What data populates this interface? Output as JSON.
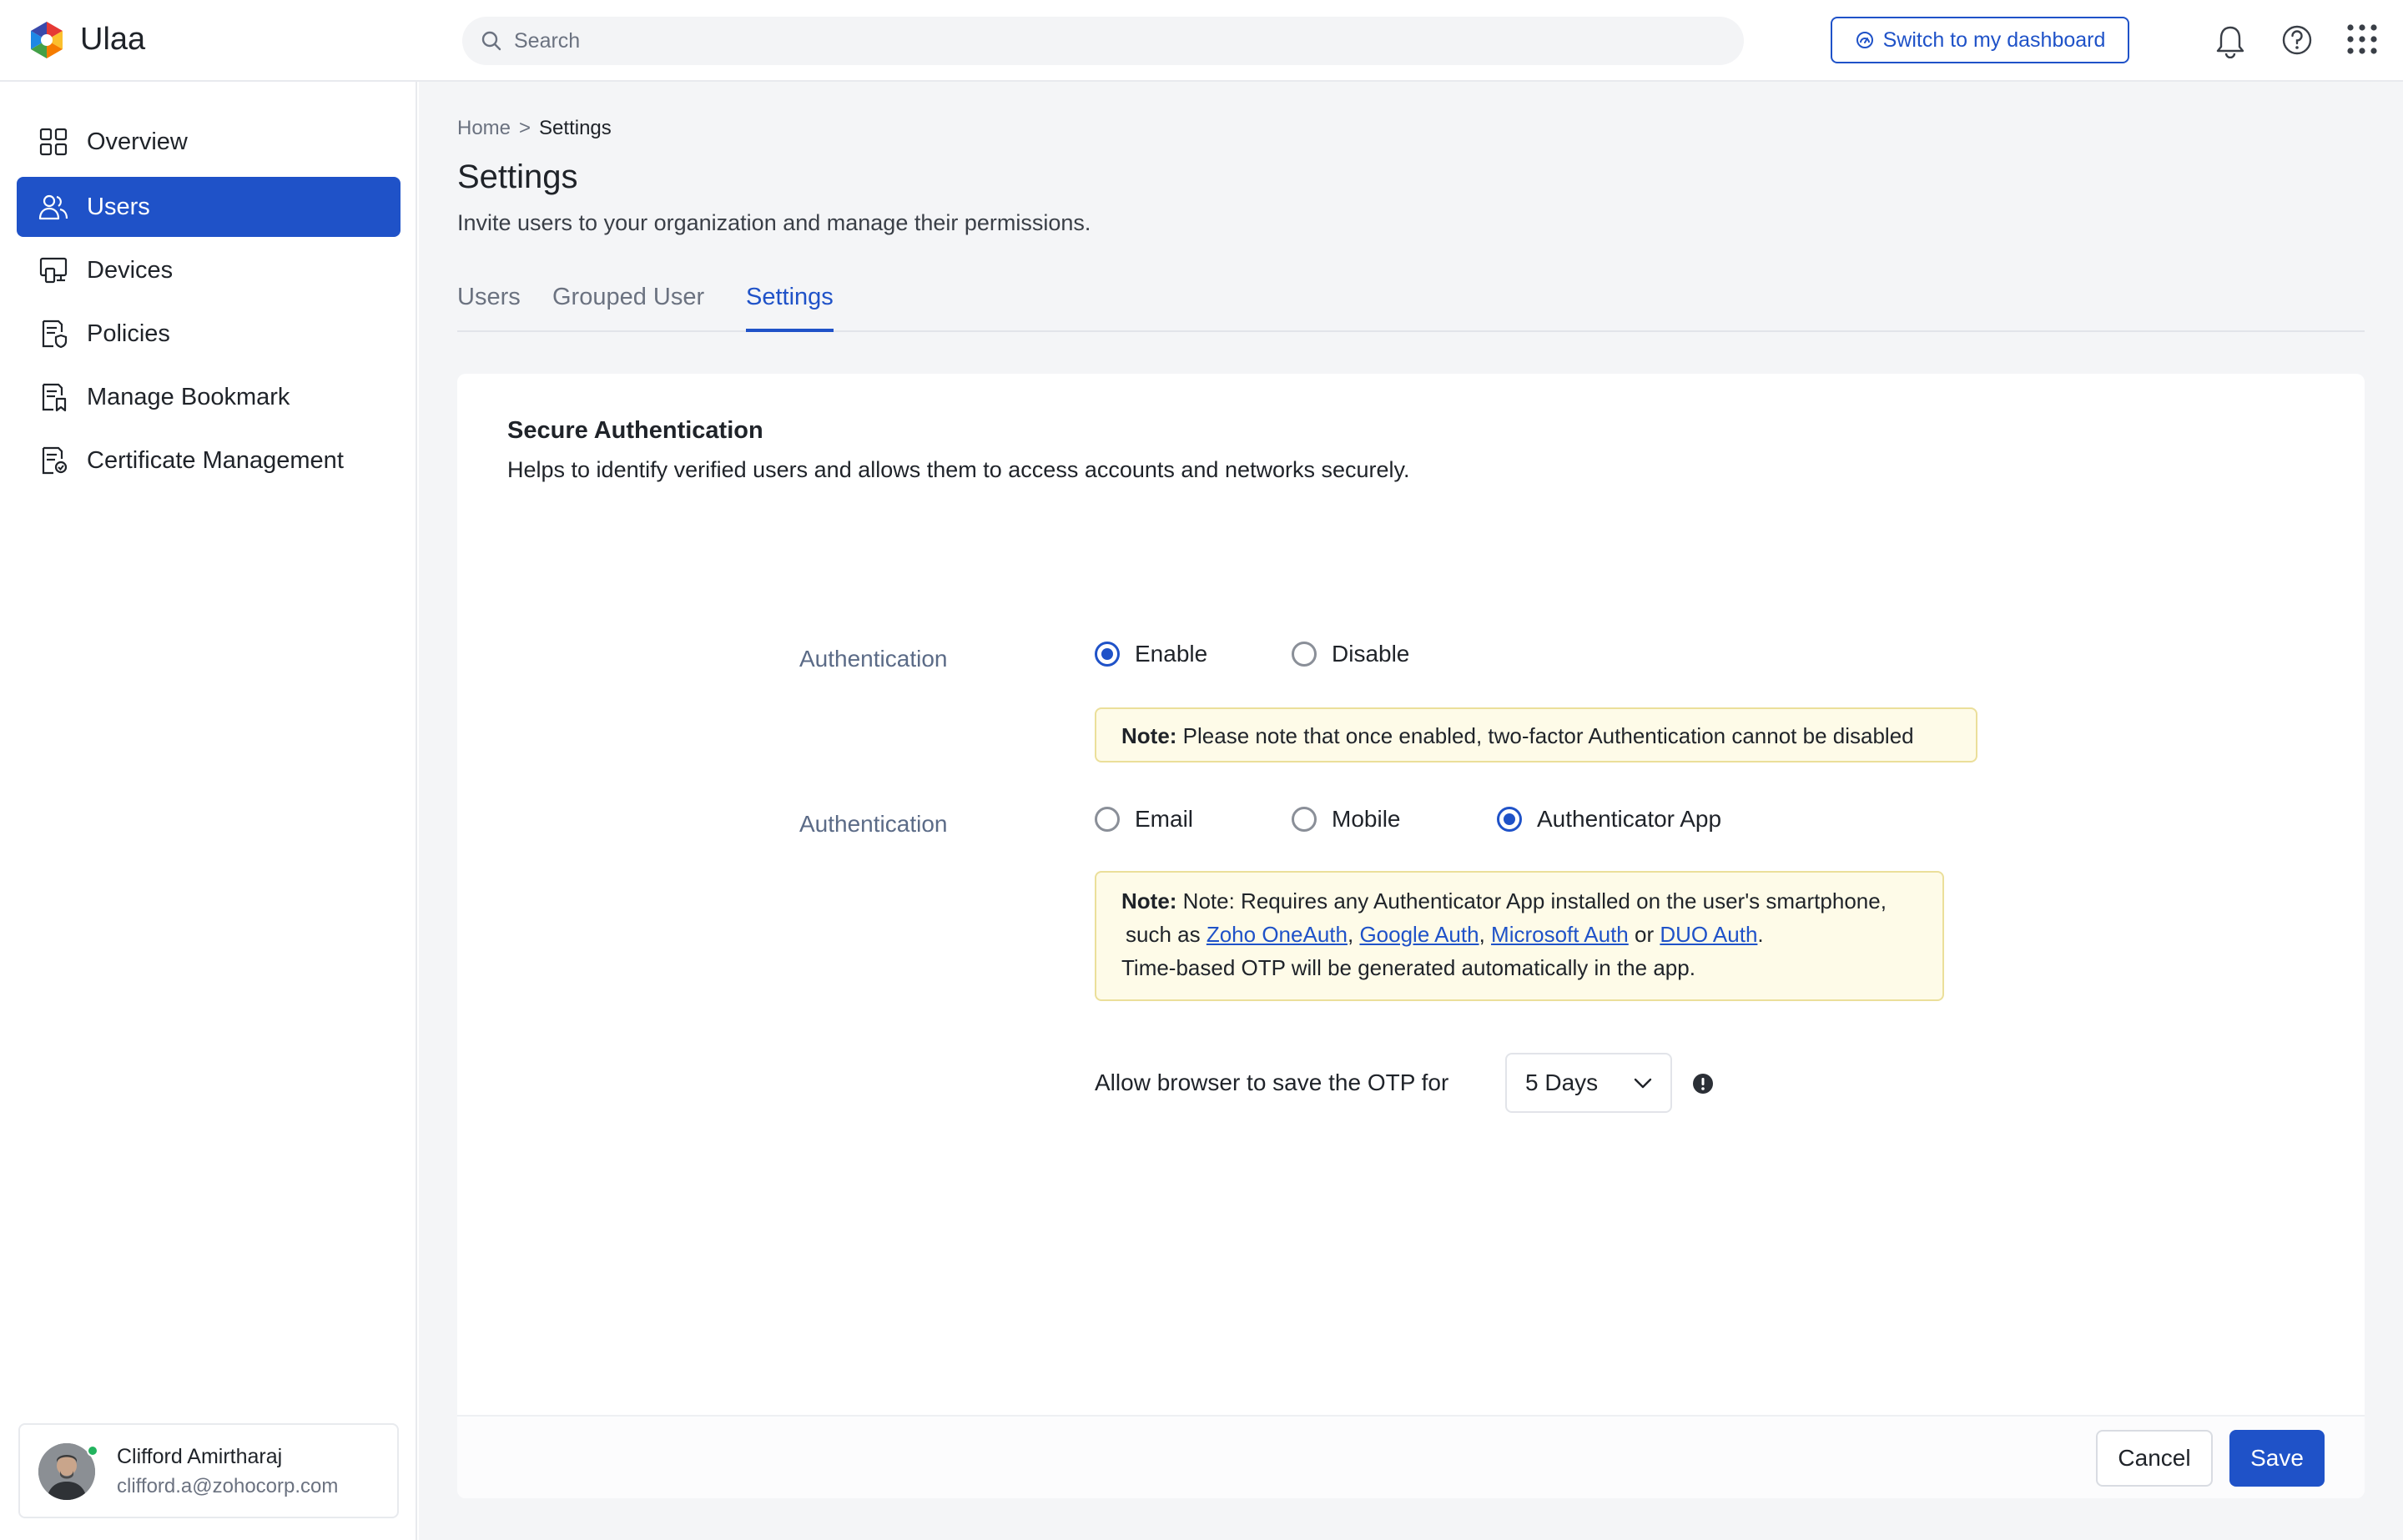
{
  "app": {
    "name": "Ulaa"
  },
  "header": {
    "search_placeholder": "Search",
    "switch_label": "Switch to my dashboard"
  },
  "sidebar": {
    "items": [
      {
        "label": "Overview",
        "icon": "grid-icon",
        "active": false
      },
      {
        "label": "Users",
        "icon": "users-icon",
        "active": true
      },
      {
        "label": "Devices",
        "icon": "devices-icon",
        "active": false
      },
      {
        "label": "Policies",
        "icon": "policy-icon",
        "active": false
      },
      {
        "label": "Manage Bookmark",
        "icon": "bookmark-icon",
        "active": false
      },
      {
        "label": "Certificate Management",
        "icon": "certificate-icon",
        "active": false
      }
    ],
    "user": {
      "name": "Clifford Amirtharaj",
      "email": "clifford.a@zohocorp.com"
    }
  },
  "breadcrumb": {
    "home": "Home",
    "separator": ">",
    "current": "Settings"
  },
  "page": {
    "title": "Settings",
    "subtitle": "Invite users to your organization and manage their permissions."
  },
  "tabs": [
    {
      "label": "Users",
      "active": false
    },
    {
      "label": "Grouped User",
      "active": false
    },
    {
      "label": "Settings",
      "active": true
    }
  ],
  "secure_auth": {
    "title": "Secure Authentication",
    "description": "Helps to identify verified users and allows them to access accounts and networks securely.",
    "toggle": {
      "label": "Authentication",
      "options": [
        "Enable",
        "Disable"
      ],
      "selected": "Enable",
      "note_label": "Note:",
      "note_text": "Please note that once enabled, two-factor Authentication cannot be disabled"
    },
    "method": {
      "label": "Authentication",
      "options": [
        "Email",
        "Mobile",
        "Authenticator App"
      ],
      "selected": "Authenticator App",
      "note_label": "Note:",
      "note_line1": "Note: Requires any Authenticator App installed on the user's smartphone,",
      "note_prefix": "such as",
      "apps": [
        "Zoho OneAuth",
        "Google Auth",
        "Microsoft Auth",
        "DUO Auth"
      ],
      "comma": ",",
      "or": "or",
      "period": ".",
      "note_line3": "Time-based OTP will be generated automatically in the app."
    },
    "otp": {
      "label": "Allow browser to save the OTP for",
      "value": "5 Days"
    }
  },
  "footer": {
    "cancel": "Cancel",
    "save": "Save"
  },
  "colors": {
    "accent": "#1f52c8",
    "note_bg": "#fefbe8",
    "note_border": "#ebdf9a",
    "presence": "#22b35e"
  }
}
